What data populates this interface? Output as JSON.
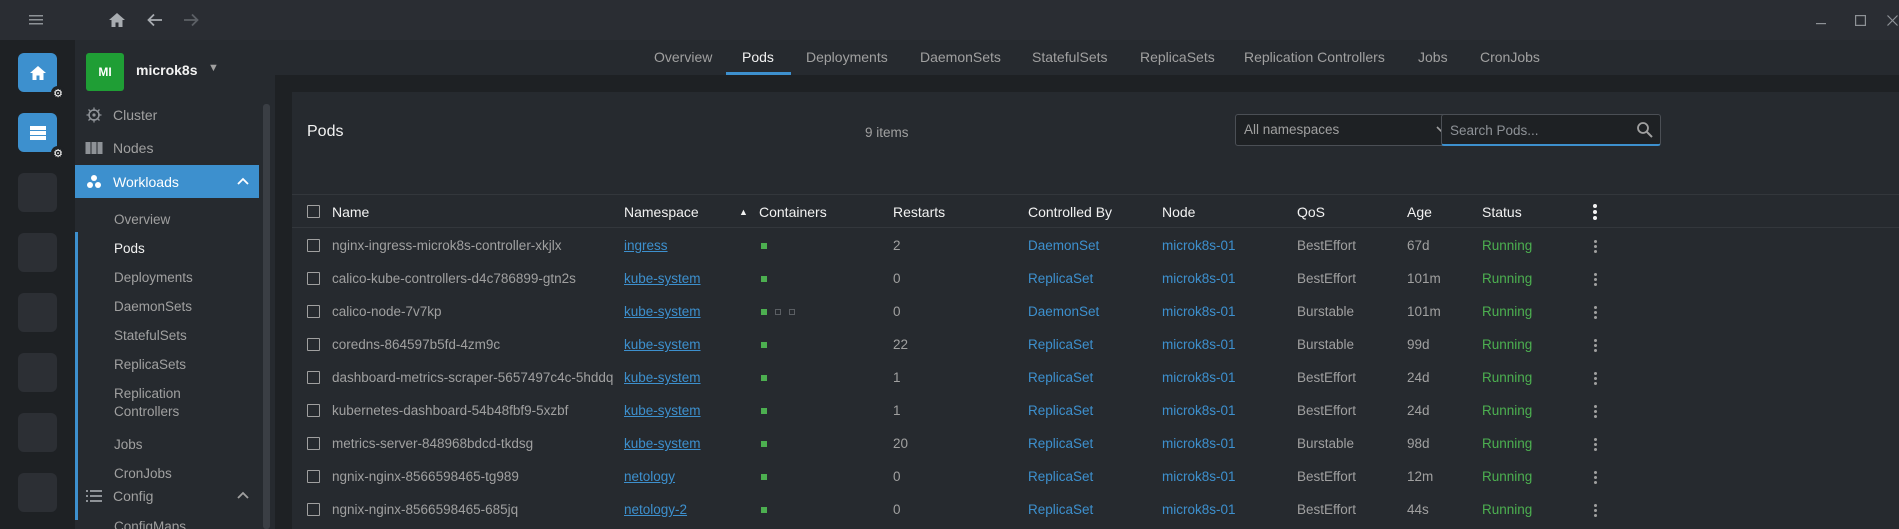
{
  "app": {
    "menu_icon": "hamburger-icon",
    "home_icon": "home-icon",
    "back_icon": "arrow-left-icon",
    "forward_icon": "arrow-right-icon"
  },
  "window": {
    "minimize": "–",
    "maximize": "☐",
    "close": "✕"
  },
  "cluster": {
    "avatar": "MI",
    "name": "microk8s",
    "caret": "▼"
  },
  "sidebar": {
    "cluster_label": "Cluster",
    "nodes_label": "Nodes",
    "workloads_label": "Workloads",
    "workloads_chevron": "⌃",
    "workloads_items": [
      "Overview",
      "Pods",
      "Deployments",
      "DaemonSets",
      "StatefulSets",
      "ReplicaSets",
      "Replication",
      "Controllers",
      "Jobs",
      "CronJobs"
    ],
    "config_label": "Config",
    "config_chevron": "⌃",
    "configmaps_label": "ConfigMaps"
  },
  "tabs": [
    "Overview",
    "Pods",
    "Deployments",
    "DaemonSets",
    "StatefulSets",
    "ReplicaSets",
    "Replication Controllers",
    "Jobs",
    "CronJobs"
  ],
  "active_tab": "Pods",
  "panel": {
    "title": "Pods",
    "count": "9 items",
    "namespace_select": "All namespaces",
    "search_placeholder": "Search Pods..."
  },
  "columns": [
    "Name",
    "Namespace",
    "Containers",
    "Restarts",
    "Controlled By",
    "Node",
    "QoS",
    "Age",
    "Status"
  ],
  "sort_indicator": "▲",
  "rows": [
    {
      "name": "nginx-ingress-microk8s-controller-xkjlx",
      "namespace": "ingress",
      "containers": [
        true
      ],
      "restarts": "2",
      "controlled_by": "DaemonSet",
      "node": "microk8s-01",
      "qos": "BestEffort",
      "age": "67d",
      "status": "Running"
    },
    {
      "name": "calico-kube-controllers-d4c786899-gtn2s",
      "namespace": "kube-system",
      "containers": [
        true
      ],
      "restarts": "0",
      "controlled_by": "ReplicaSet",
      "node": "microk8s-01",
      "qos": "BestEffort",
      "age": "101m",
      "status": "Running"
    },
    {
      "name": "calico-node-7v7kp",
      "namespace": "kube-system",
      "containers": [
        true,
        false,
        false
      ],
      "restarts": "0",
      "controlled_by": "DaemonSet",
      "node": "microk8s-01",
      "qos": "Burstable",
      "age": "101m",
      "status": "Running"
    },
    {
      "name": "coredns-864597b5fd-4zm9c",
      "namespace": "kube-system",
      "containers": [
        true
      ],
      "restarts": "22",
      "controlled_by": "ReplicaSet",
      "node": "microk8s-01",
      "qos": "Burstable",
      "age": "99d",
      "status": "Running"
    },
    {
      "name": "dashboard-metrics-scraper-5657497c4c-5hddq",
      "namespace": "kube-system",
      "containers": [
        true
      ],
      "restarts": "1",
      "controlled_by": "ReplicaSet",
      "node": "microk8s-01",
      "qos": "BestEffort",
      "age": "24d",
      "status": "Running"
    },
    {
      "name": "kubernetes-dashboard-54b48fbf9-5xzbf",
      "namespace": "kube-system",
      "containers": [
        true
      ],
      "restarts": "1",
      "controlled_by": "ReplicaSet",
      "node": "microk8s-01",
      "qos": "BestEffort",
      "age": "24d",
      "status": "Running"
    },
    {
      "name": "metrics-server-848968bdcd-tkdsg",
      "namespace": "kube-system",
      "containers": [
        true
      ],
      "restarts": "20",
      "controlled_by": "ReplicaSet",
      "node": "microk8s-01",
      "qos": "Burstable",
      "age": "98d",
      "status": "Running"
    },
    {
      "name": "ngnix-nginx-8566598465-tg989",
      "namespace": "netology",
      "containers": [
        true
      ],
      "restarts": "0",
      "controlled_by": "ReplicaSet",
      "node": "microk8s-01",
      "qos": "BestEffort",
      "age": "12m",
      "status": "Running"
    },
    {
      "name": "ngnix-nginx-8566598465-685jq",
      "namespace": "netology-2",
      "containers": [
        true
      ],
      "restarts": "0",
      "controlled_by": "ReplicaSet",
      "node": "microk8s-01",
      "qos": "BestEffort",
      "age": "44s",
      "status": "Running"
    }
  ],
  "colors": {
    "accent": "#3d90ce",
    "running": "#4caf50",
    "avatar": "#1f9e35"
  }
}
